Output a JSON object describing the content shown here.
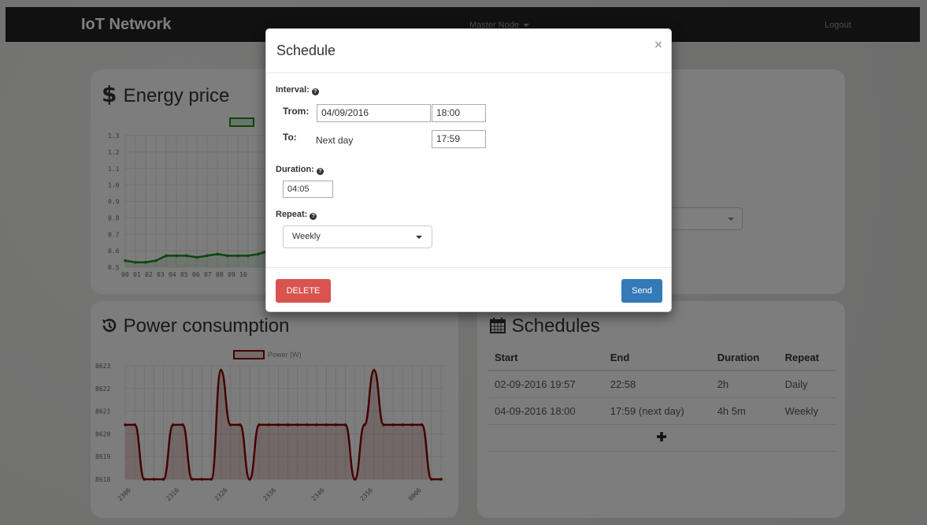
{
  "navbar": {
    "brand": "IoT Network",
    "center": "Master Node",
    "logout": "Logout"
  },
  "energy": {
    "title": "Energy price",
    "icon": "dollar-icon",
    "chart_data": {
      "type": "line",
      "color": "#1a8c1a",
      "y_ticks": [
        "1.3",
        "1.2",
        "1.1",
        "1.0",
        "0.9",
        "0.8",
        "0.7",
        "0.6",
        "0.5"
      ],
      "ylim": [
        0.5,
        1.3
      ],
      "x_ticks": [
        "00",
        "01",
        "02",
        "03",
        "04",
        "05",
        "06",
        "07",
        "08",
        "09",
        "10"
      ],
      "visible_values": [
        0.54,
        0.53,
        0.53,
        0.54,
        0.57,
        0.57,
        0.57,
        0.56,
        0.57,
        0.58,
        0.57,
        0.57,
        0.57,
        0.58,
        0.6,
        0.58,
        0.59
      ]
    }
  },
  "power": {
    "title": "Power consumption",
    "icon": "history-icon",
    "chart_data": {
      "type": "area",
      "color": "#8b0000",
      "legend": "Power (W)",
      "y_ticks": [
        "8623",
        "8622",
        "8621",
        "8620",
        "8619",
        "8618"
      ],
      "ylim": [
        8618,
        8623
      ],
      "x_ticks": [
        "2306",
        "2316",
        "2326",
        "2336",
        "2346",
        "2356",
        "0006"
      ],
      "values": [
        8620.4,
        8620.4,
        8618,
        8618,
        8618,
        8620.4,
        8620.4,
        8618,
        8618,
        8618,
        8622.8,
        8620.4,
        8620.4,
        8618,
        8620.4,
        8620.4,
        8620.4,
        8620.4,
        8620.4,
        8620.4,
        8620.4,
        8620.4,
        8620.4,
        8620.4,
        8618,
        8620.4,
        8622.8,
        8620.4,
        8620.4,
        8620.4,
        8620.4,
        8620.4,
        8618,
        8618
      ]
    }
  },
  "schedules": {
    "title": "Schedules",
    "icon": "calendar-icon",
    "columns": [
      "Start",
      "End",
      "Duration",
      "Repeat"
    ],
    "rows": [
      [
        "02-09-2016 19:57",
        "22:58",
        "2h",
        "Daily"
      ],
      [
        "04-09-2016 18:00",
        "17:59 (next day)",
        "4h 5m",
        "Weekly"
      ]
    ],
    "add_icon": "plus-icon"
  },
  "modal": {
    "title": "Schedule",
    "close": "×",
    "interval_label": "Interval:",
    "from_label": "Trom:",
    "from_date": "04/09/2016",
    "from_time": "18:00",
    "to_label": "To:",
    "to_text": "Next day",
    "to_time": "17:59",
    "duration_label": "Duration:",
    "duration_value": "04:05",
    "repeat_label": "Repeat:",
    "repeat_value": "Weekly",
    "delete_label": "DELETE",
    "send_label": "Send"
  }
}
